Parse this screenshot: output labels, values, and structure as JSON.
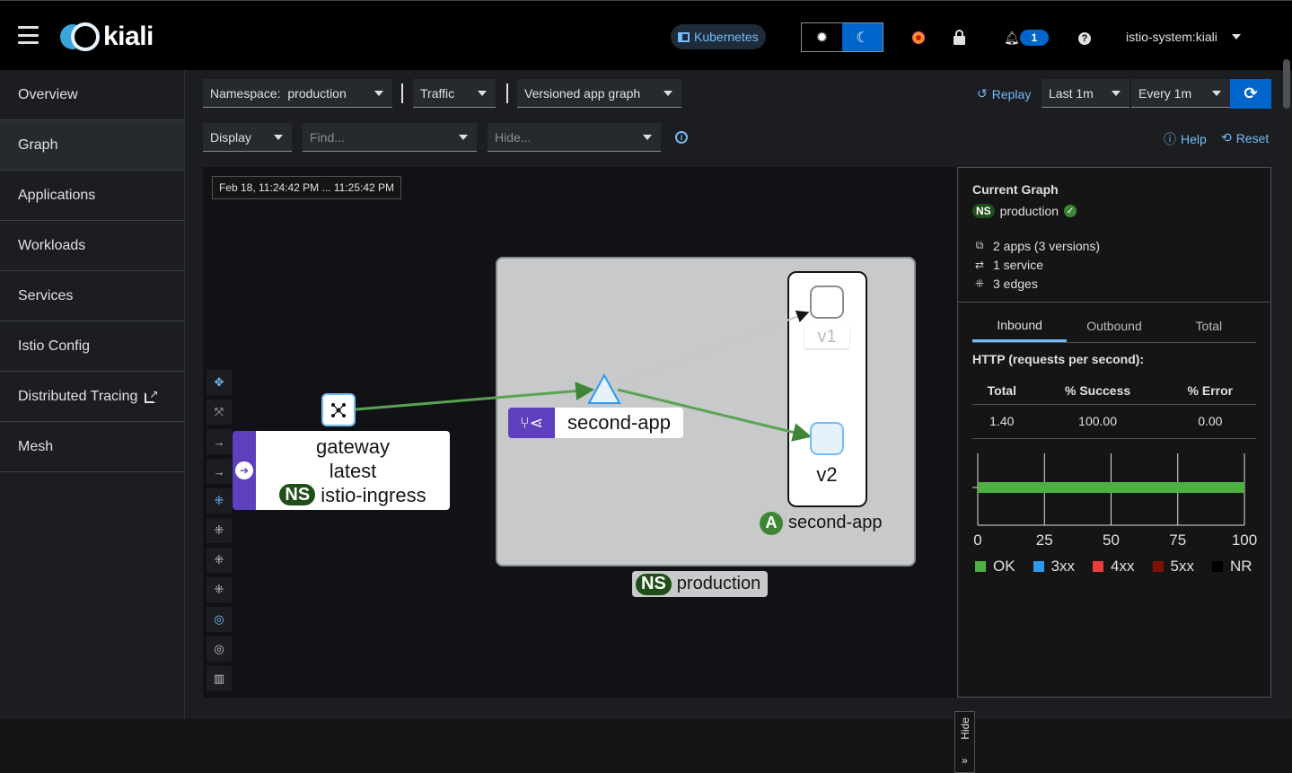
{
  "masthead": {
    "logo_text": "kiali",
    "cluster_badge": "Kubernetes",
    "theme_light_icon": "sun-icon",
    "theme_dark_icon": "moon-icon",
    "notification_count": "1",
    "help_glyph": "?",
    "user": "istio-system:kiali"
  },
  "sidebar": {
    "items": [
      {
        "label": "Overview"
      },
      {
        "label": "Graph"
      },
      {
        "label": "Applications"
      },
      {
        "label": "Workloads"
      },
      {
        "label": "Services"
      },
      {
        "label": "Istio Config"
      },
      {
        "label": "Distributed Tracing"
      },
      {
        "label": "Mesh"
      }
    ]
  },
  "toolbar": {
    "namespace_prefix": "Namespace:",
    "namespace_value": "production",
    "traffic": "Traffic",
    "graph_type": "Versioned app graph",
    "replay": "Replay",
    "duration": "Last 1m",
    "refresh_interval": "Every 1m",
    "display": "Display",
    "find_placeholder": "Find...",
    "hide_placeholder": "Hide...",
    "help": "Help",
    "reset": "Reset"
  },
  "graph": {
    "timestamp": "Feb 18, 11:24:42 PM ... 11:25:42 PM",
    "namespace_box": {
      "badge": "NS",
      "label": "production"
    },
    "app_box": {
      "badge": "A",
      "label": "second-app"
    },
    "service": {
      "label": "second-app"
    },
    "workloads": [
      {
        "label": "v1"
      },
      {
        "label": "v2"
      }
    ],
    "gateway": {
      "line1": "gateway",
      "line2": "latest",
      "badge": "NS",
      "namespace": "istio-ingress"
    },
    "hide_tab": "Hide"
  },
  "panel": {
    "title": "Current Graph",
    "ns_badge": "NS",
    "namespace": "production",
    "stats": {
      "apps": "2 apps (3 versions)",
      "services": "1 service",
      "edges": "3 edges"
    },
    "tabs": [
      "Inbound",
      "Outbound",
      "Total"
    ],
    "active_tab": "Inbound",
    "http_title": "HTTP (requests per second):",
    "table": {
      "headers": [
        "Total",
        "% Success",
        "% Error"
      ],
      "row": [
        "1.40",
        "100.00",
        "0.00"
      ]
    },
    "legend": [
      {
        "label": "OK",
        "color": "#4cb140"
      },
      {
        "label": "3xx",
        "color": "#2b9af3"
      },
      {
        "label": "4xx",
        "color": "#ec3b3b"
      },
      {
        "label": "5xx",
        "color": "#7d1007"
      },
      {
        "label": "NR",
        "color": "#000000"
      }
    ]
  },
  "chart_data": {
    "type": "bar",
    "orientation": "horizontal",
    "categories": [
      ""
    ],
    "series": [
      {
        "name": "OK",
        "values": [
          100
        ]
      },
      {
        "name": "3xx",
        "values": [
          0
        ]
      },
      {
        "name": "4xx",
        "values": [
          0
        ]
      },
      {
        "name": "5xx",
        "values": [
          0
        ]
      },
      {
        "name": "NR",
        "values": [
          0
        ]
      }
    ],
    "ticks": [
      "0",
      "25",
      "50",
      "75",
      "100"
    ],
    "xlim": [
      0,
      100
    ],
    "grid": true,
    "legend_position": "bottom"
  }
}
